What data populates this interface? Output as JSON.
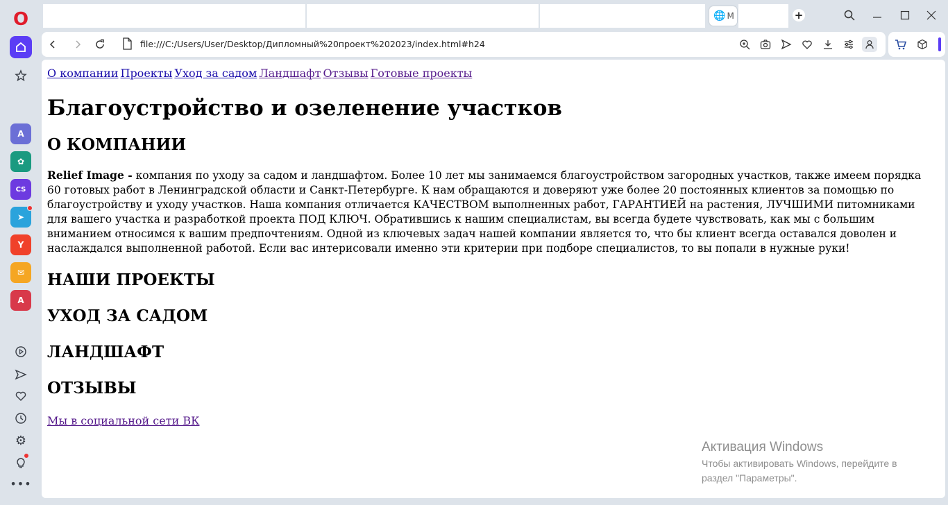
{
  "browser": {
    "active_tab_label": "M",
    "new_tab_symbol": "+",
    "url": "file:///C:/Users/User/Desktop/Дипломный%20проект%202023/index.html#h24"
  },
  "page": {
    "nav": [
      "О компании",
      "Проекты",
      "Уход за садом",
      "Ландшафт",
      "Отзывы",
      "Готовые проекты"
    ],
    "title": "Благоустройство и озеленение участков",
    "section_company": "О КОМПАНИИ",
    "intro_brand": "Relief Image -",
    "intro_text": " компания по уходу за садом и ландшафтом. Более 10 лет мы занимаемся благоустройством загородных участков, также имеем порядка 60 готовых работ в Ленинградской области и Санкт-Петербурге. К нам обращаются и доверяют уже более 20 постоянных клиентов за помощью по благоустройству и уходу участков. Наша компания отличается КАЧЕСТВОМ выполненных работ, ГАРАНТИЕЙ на растения, ЛУЧШИМИ питомниками для вашего участка и разработкой проекта ПОД КЛЮЧ. Обратившись к нашим специалистам, вы всегда будете чувствовать, как мы с большим вниманием относимся к вашим предпочтениям. Одной из ключевых задач нашей компании является то, что бы клиент всегда оставался доволен и наслаждался выполненной работой. Если вас интерисовали именно эти критерии при подборе специалистов, то вы попали в нужные руки!",
    "section_projects": "НАШИ ПРОЕКТЫ",
    "section_garden": "УХОД ЗА САДОМ",
    "section_landscape": "ЛАНДШАФТ",
    "section_reviews": "ОТЗЫВЫ",
    "vk_link": "Мы в социальной сети ВК"
  },
  "watermark": {
    "title": "Активация Windows",
    "line1": "Чтобы активировать Windows, перейдите в",
    "line2": "раздел \"Параметры\"."
  },
  "colors": {
    "accent": "#5b3df5",
    "opera_red": "#e01c2b",
    "link": "#1a0dab",
    "link_visited": "#551a8b"
  },
  "icons": {
    "sidebar": [
      "opera-logo-icon",
      "home-icon",
      "star-icon",
      "aria-icon",
      "chatgpt-icon",
      "chatsonic-icon",
      "telegram-icon",
      "yandex-icon",
      "mail-icon",
      "translate-icon",
      "player-icon",
      "send-icon",
      "heart-icon",
      "history-icon",
      "settings-icon",
      "tips-icon",
      "more-icon"
    ],
    "toolbar": [
      "back-icon",
      "forward-icon",
      "reload-icon",
      "page-icon",
      "zoom-icon",
      "camera-icon",
      "send-icon",
      "heart-icon",
      "download-icon",
      "easy-setup-icon",
      "profile-icon",
      "cart-icon",
      "box-icon"
    ]
  }
}
